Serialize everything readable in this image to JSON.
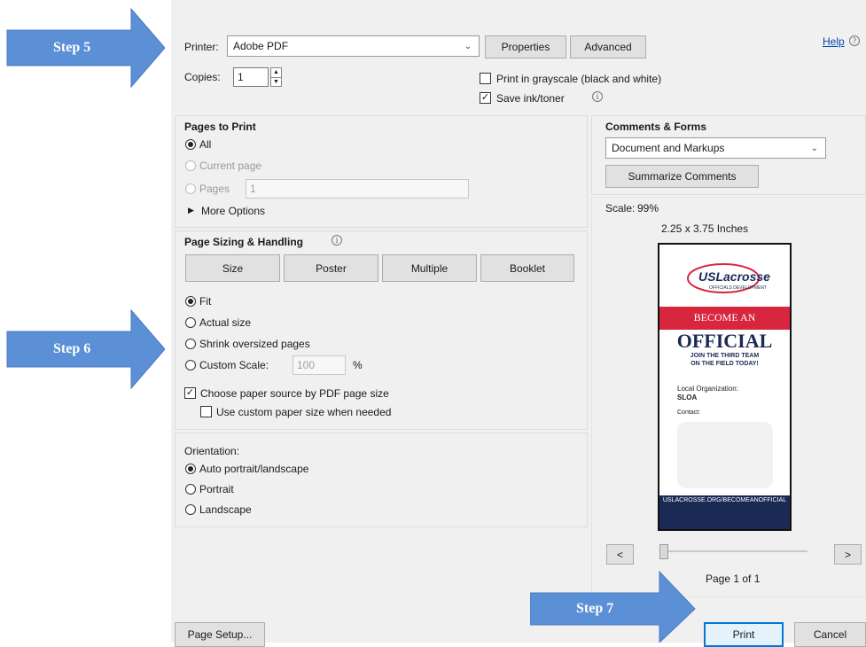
{
  "printer": {
    "label": "Printer:",
    "value": "Adobe PDF",
    "properties_label": "Properties",
    "advanced_label": "Advanced",
    "help_label": "Help"
  },
  "copies": {
    "label": "Copies:",
    "value": "1"
  },
  "options": {
    "grayscale_label": "Print in grayscale (black and white)",
    "grayscale_checked": false,
    "save_ink_label": "Save ink/toner",
    "save_ink_checked": true
  },
  "pages_to_print": {
    "title": "Pages to Print",
    "all_label": "All",
    "current_label": "Current page",
    "pages_label": "Pages",
    "pages_value": "1",
    "more_options_label": "More Options"
  },
  "sizing": {
    "title": "Page Sizing & Handling",
    "tabs": [
      "Size",
      "Poster",
      "Multiple",
      "Booklet"
    ],
    "fit_label": "Fit",
    "actual_label": "Actual size",
    "shrink_label": "Shrink oversized pages",
    "custom_label": "Custom Scale:",
    "custom_value": "100",
    "percent": "%",
    "paper_source_label": "Choose paper source by PDF page size",
    "custom_paper_label": "Use custom paper size when needed"
  },
  "orientation": {
    "title": "Orientation:",
    "auto_label": "Auto portrait/landscape",
    "portrait_label": "Portrait",
    "landscape_label": "Landscape"
  },
  "comments": {
    "title": "Comments & Forms",
    "value": "Document and Markups",
    "summarize_label": "Summarize Comments"
  },
  "preview": {
    "scale_label": "Scale:",
    "scale_value": "99%",
    "size_text": "2.25 x 3.75 Inches",
    "prev_label": "<",
    "next_label": ">",
    "page_text": "Page 1 of 1",
    "card": {
      "logo_text": "USLacrosse",
      "logo_sub": "OFFICIALS DEVELOPMENT",
      "banner": "BECOME AN",
      "headline": "OFFICIAL",
      "tagline_1": "JOIN THE THIRD TEAM",
      "tagline_2": "ON THE FIELD TODAY!",
      "org_label": "Local Organization:",
      "org_value": "SLOA",
      "contact_label": "Contact:",
      "footer": "USLACROSSE.ORG/BECOMEANOFFICIAL"
    }
  },
  "footer": {
    "page_setup_label": "Page Setup...",
    "print_label": "Print",
    "cancel_label": "Cancel"
  },
  "steps": {
    "step5": "Step 5",
    "step6": "Step 6",
    "step7": "Step 7"
  },
  "colors": {
    "arrow": "#5b8fd6",
    "accent": "#0078d7",
    "help_link": "#0645ad",
    "card_red": "#d7263d",
    "card_navy": "#1b2a55"
  }
}
